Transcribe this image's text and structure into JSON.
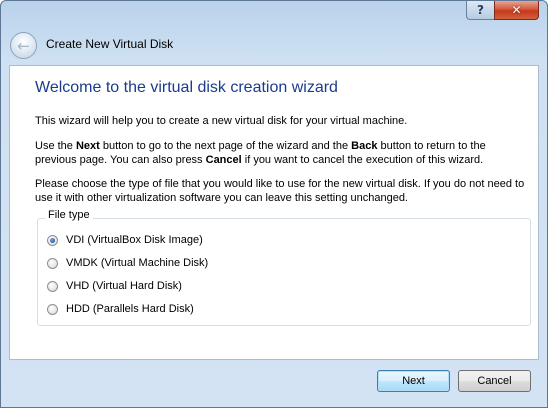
{
  "window": {
    "title": "Create New Virtual Disk",
    "help_glyph": "?",
    "close_glyph": "✕",
    "back_glyph": "←"
  },
  "wizard": {
    "heading": "Welcome to the virtual disk creation wizard",
    "intro": "This wizard will help you to create a new virtual disk for your virtual machine.",
    "nav_text": {
      "part1": "Use the ",
      "next_word": "Next",
      "part2": " button to go to the next page of the wizard and the ",
      "back_word": "Back",
      "part3": " button to return to the previous page. You can also press ",
      "cancel_word": "Cancel",
      "part4": " if you want to cancel the execution of this wizard."
    },
    "choose_text": "Please choose the type of file that you would like to use for the new virtual disk. If you do not need to use it with other virtualization software you can leave this setting unchanged."
  },
  "file_type": {
    "legend": "File type",
    "selected_index": 0,
    "options": [
      {
        "label": "VDI (VirtualBox Disk Image)",
        "checked": true
      },
      {
        "label": "VMDK (Virtual Machine Disk)",
        "checked": false
      },
      {
        "label": "VHD (Virtual Hard Disk)",
        "checked": false
      },
      {
        "label": "HDD (Parallels Hard Disk)",
        "checked": false
      }
    ]
  },
  "buttons": {
    "next_label": "Next",
    "cancel_label": "Cancel"
  },
  "colors": {
    "heading": "#1a3c8c",
    "close_button": "#c4391b",
    "default_button_border": "#3c7fb1",
    "radio_selected": "#2a5ea6"
  }
}
